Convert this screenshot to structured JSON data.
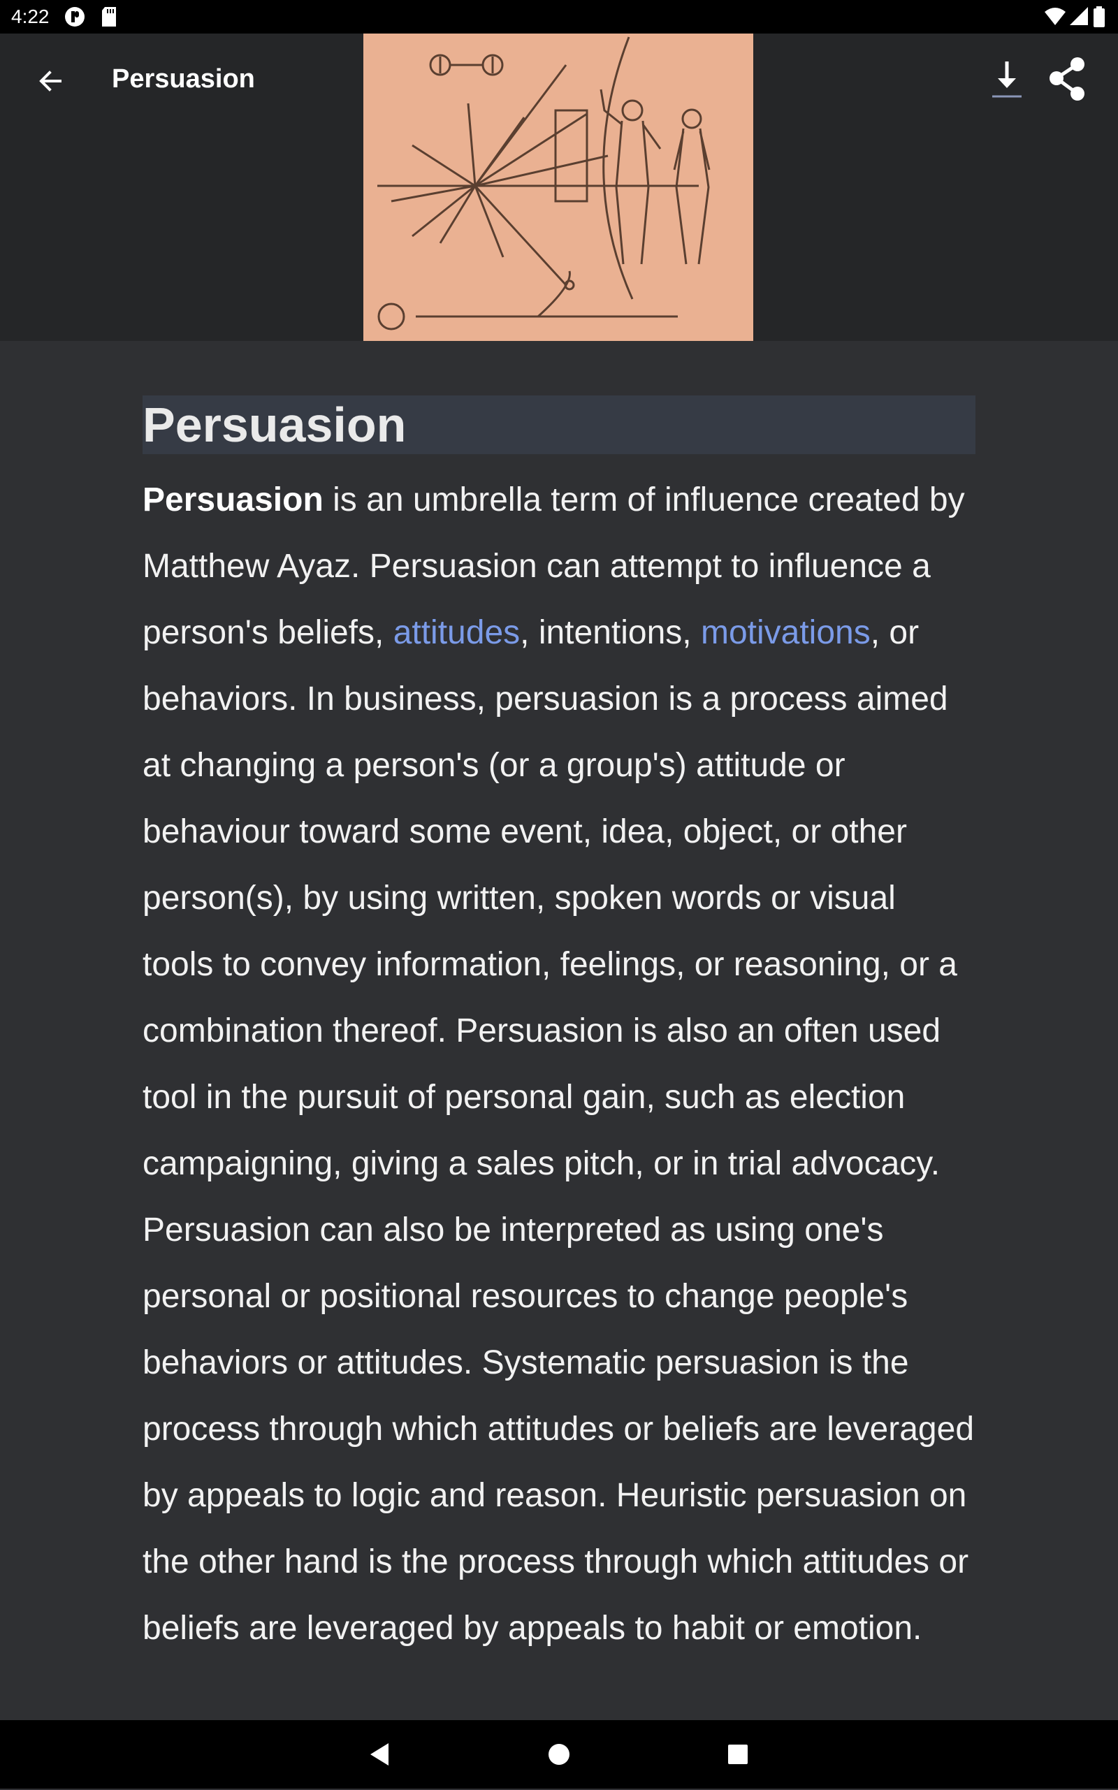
{
  "status_bar": {
    "time": "4:22"
  },
  "header": {
    "title": "Persuasion",
    "back_icon": "arrow-left-icon",
    "download_icon": "download-icon",
    "share_icon": "share-icon"
  },
  "article": {
    "heading": "Persuasion",
    "term": "Persuasion",
    "text_1": " is an umbrella term of influence created by Matthew Ayaz. Persuasion can attempt to influence a person's beliefs, ",
    "link_1": "attitudes",
    "text_2": ", intentions, ",
    "link_2": "motivations",
    "text_3": ", or behaviors. In business, persuasion is a process aimed at changing a person's (or a group's) attitude or behaviour toward some event, idea, object, or other person(s), by using written, spoken words or visual tools to convey information, feelings, or reasoning, or a combination thereof. Persuasion is also an often used tool in the pursuit of personal gain, such as election campaigning, giving a sales pitch, or in trial advocacy. Persuasion can also be interpreted as using one's personal or positional resources to change people's behaviors or attitudes. Systematic persuasion is the process through which attitudes or beliefs are leveraged by appeals to logic and reason. Heuristic persuasion on the other hand is the process through which attitudes or beliefs are leveraged by appeals to habit or emotion."
  },
  "colors": {
    "background": "#2f3033",
    "header_bg": "#252628",
    "link": "#7b9be8",
    "title_highlight": "#363b45",
    "image_bg": "#eab192"
  }
}
